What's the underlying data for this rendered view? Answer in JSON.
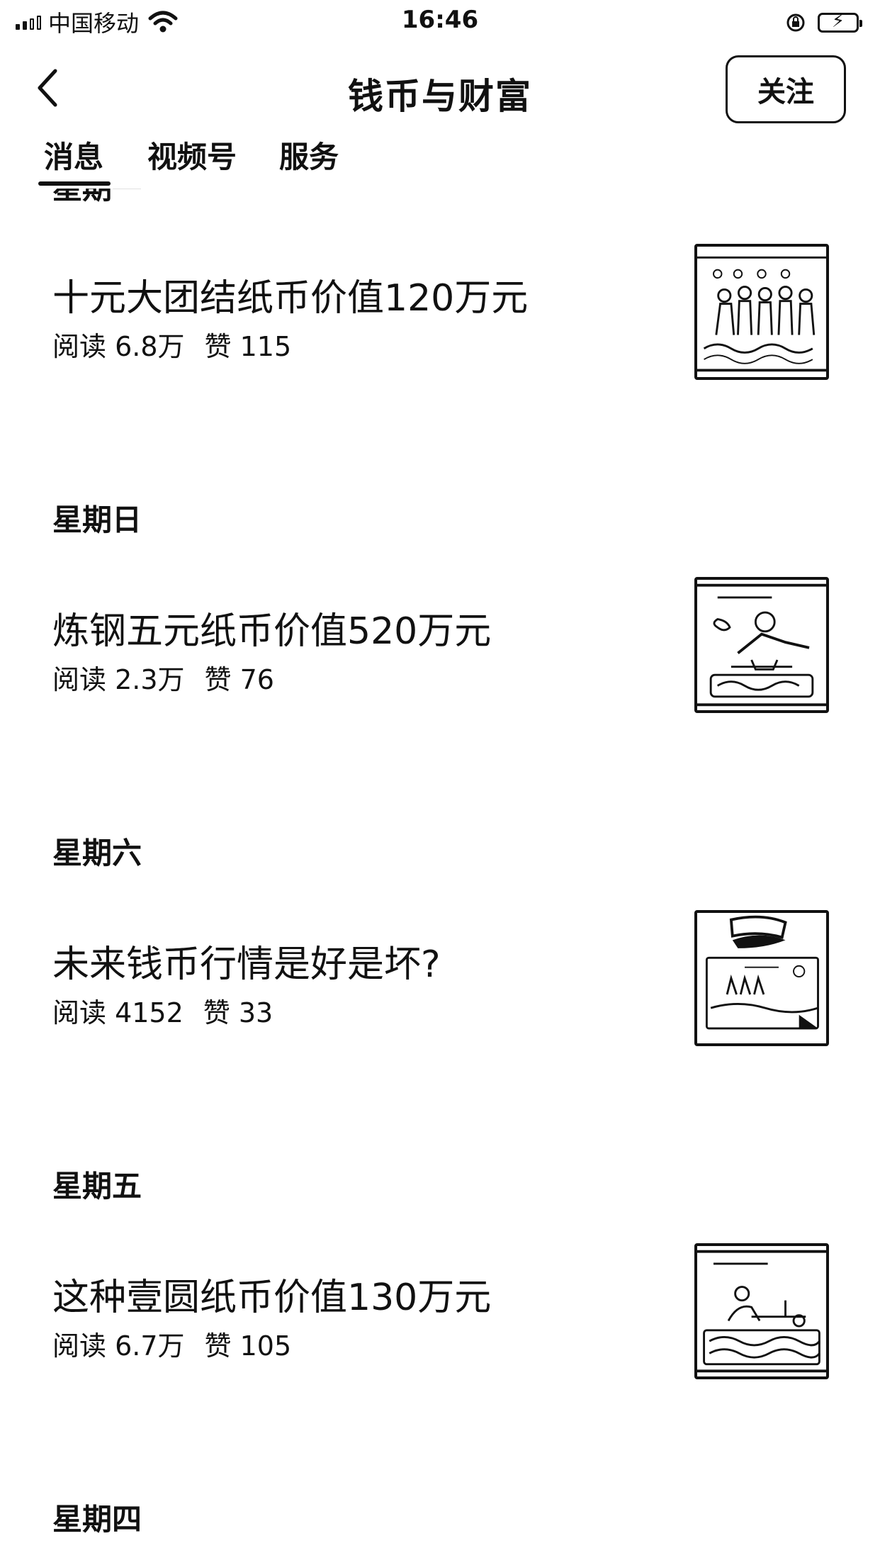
{
  "status_bar": {
    "carrier": "中国移动",
    "time": "16:46",
    "battery_glyph": "⚡"
  },
  "nav": {
    "title": "钱币与财富",
    "follow_label": "关注"
  },
  "tabs": [
    {
      "label": "消息",
      "active": true
    },
    {
      "label": "视频号",
      "active": false
    },
    {
      "label": "服务",
      "active": false
    }
  ],
  "feed": [
    {
      "day": "星期一",
      "title": "十元大团结纸币价值120万元",
      "reads": "阅读 6.8万",
      "likes": "赞 115",
      "thumb_icon": "banknote-group-icon"
    },
    {
      "day": "星期日",
      "title": "炼钢五元纸币价值520万元",
      "reads": "阅读 2.3万",
      "likes": "赞 76",
      "thumb_icon": "banknote-steelworker-icon"
    },
    {
      "day": "星期六",
      "title": "未来钱币行情是好是坏?",
      "reads": "阅读 4152",
      "likes": "赞 33",
      "thumb_icon": "banknote-stack-icon"
    },
    {
      "day": "星期五",
      "title": "这种壹圆纸币价值130万元",
      "reads": "阅读 6.7万",
      "likes": "赞 105",
      "thumb_icon": "banknote-tractor-icon"
    },
    {
      "day": "星期四"
    }
  ]
}
